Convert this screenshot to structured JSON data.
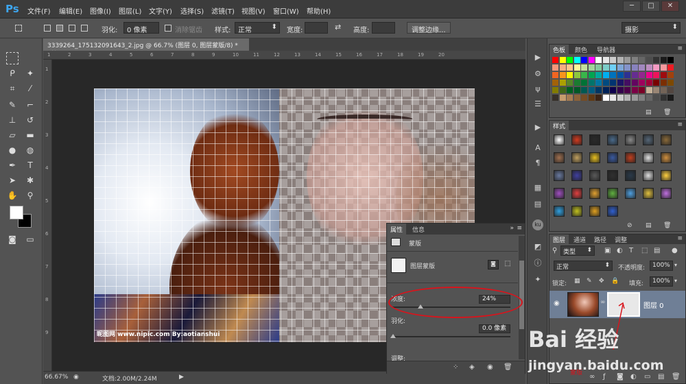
{
  "app": {
    "logo": "Ps"
  },
  "menu": [
    "文件(F)",
    "编辑(E)",
    "图像(I)",
    "图层(L)",
    "文字(Y)",
    "选择(S)",
    "滤镜(T)",
    "视图(V)",
    "窗口(W)",
    "帮助(H)"
  ],
  "window_buttons": [
    "─",
    "□",
    "✕"
  ],
  "options": {
    "feather_label": "羽化:",
    "feather_value": "0 像素",
    "antialias": "消除锯齿",
    "style_label": "样式:",
    "style_value": "正常",
    "width_label": "宽度:",
    "height_label": "高度:",
    "refine_btn": "调整边缘...",
    "workspace": "摄影"
  },
  "document": {
    "tab": "3339264_175132091643_2.jpg @ 66.7% (图层 0, 图层蒙版/8) *",
    "close": "×",
    "watermark": "昵图网 www.nipic.com    By:aotianshui"
  },
  "ruler": {
    "h": [
      "1",
      "2",
      "3",
      "4",
      "5",
      "6",
      "7",
      "8",
      "9",
      "10",
      "11",
      "12",
      "13",
      "14",
      "15",
      "16",
      "17",
      "18",
      "19",
      "20"
    ],
    "v": [
      "1",
      "2",
      "3",
      "4",
      "5",
      "6",
      "7",
      "8",
      "9"
    ]
  },
  "status": {
    "zoom": "66.67%",
    "doc": "文档:2.00M/2.24M"
  },
  "properties": {
    "tabs": [
      "属性",
      "信息"
    ],
    "title": "蒙版",
    "layer_mask": "图层蒙版",
    "density_label": "浓度:",
    "density_value": "24%",
    "density": 0.24,
    "feather_label": "羽化:",
    "feather_value": "0.0 像素",
    "adjust_label": "调整:"
  },
  "swatch_panel": {
    "tabs": [
      "色板",
      "颜色",
      "导航器"
    ]
  },
  "styles_panel": {
    "tabs": [
      "样式"
    ]
  },
  "layers_panel": {
    "tabs": [
      "图层",
      "通道",
      "路径",
      "调整"
    ],
    "filter": "类型",
    "blend": "正常",
    "opacity_label": "不透明度:",
    "opacity": "100%",
    "lock_label": "锁定:",
    "fill_label": "填充:",
    "fill": "100%",
    "layer_name": "图层 0",
    "annotation": "蒙版"
  },
  "watermark": {
    "brand": "Bai  经验",
    "url": "jingyan.baidu.com"
  },
  "colors": {
    "accent": "#3da6f0",
    "highlight": "#d8141c",
    "layer_selected": "#6f7f96"
  }
}
